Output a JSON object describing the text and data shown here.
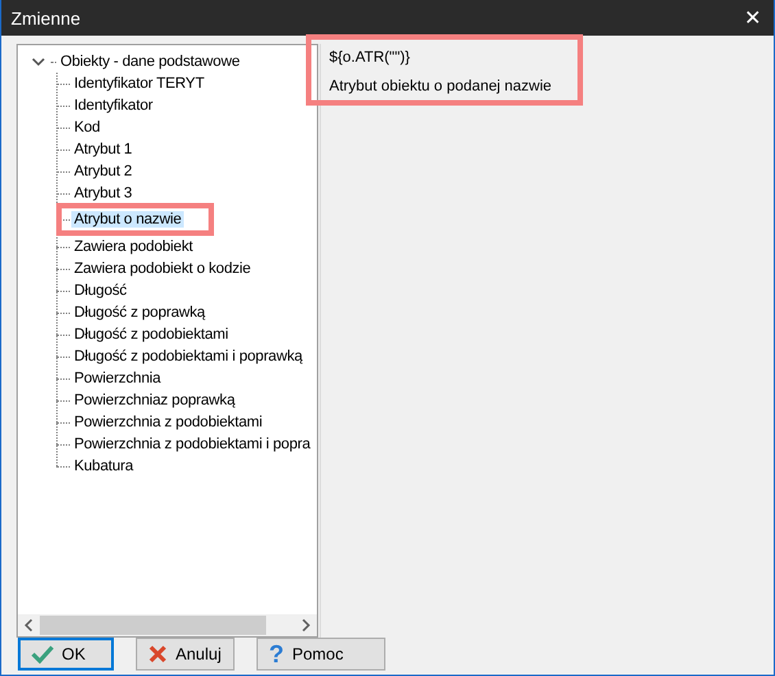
{
  "window": {
    "title": "Zmienne",
    "close": "✕"
  },
  "tree": {
    "label": "Obiekty - dane podstawowe",
    "expanded": true,
    "children": [
      {
        "label": "Identyfikator TERYT",
        "selected": false
      },
      {
        "label": "Identyfikator",
        "selected": false
      },
      {
        "label": "Kod",
        "selected": false
      },
      {
        "label": "Atrybut 1",
        "selected": false
      },
      {
        "label": "Atrybut 2",
        "selected": false
      },
      {
        "label": "Atrybut 3",
        "selected": false
      },
      {
        "label": "Atrybut o nazwie",
        "selected": true
      },
      {
        "label": "Zawiera podobiekt",
        "selected": false
      },
      {
        "label": "Zawiera podobiekt o kodzie",
        "selected": false
      },
      {
        "label": "Długość",
        "selected": false
      },
      {
        "label": "Długość z poprawką",
        "selected": false
      },
      {
        "label": "Długość z podobiektami",
        "selected": false
      },
      {
        "label": "Długość z podobiektami i poprawką",
        "selected": false
      },
      {
        "label": "Powierzchnia",
        "selected": false
      },
      {
        "label": "Powierzchniaz poprawką",
        "selected": false
      },
      {
        "label": "Powierzchnia z podobiektami",
        "selected": false
      },
      {
        "label": "Powierzchnia z podobiektami i popra",
        "selected": false
      },
      {
        "label": "Kubatura",
        "selected": false
      }
    ]
  },
  "detail": {
    "expression": "${o.ATR(\"\")}",
    "description": "Atrybut obiektu o podanej nazwie"
  },
  "buttons": [
    {
      "kind": "ok",
      "label": "OK",
      "default": true
    },
    {
      "kind": "cancel",
      "label": "Anuluj",
      "default": false
    },
    {
      "kind": "help",
      "label": "Pomoc",
      "default": false,
      "icon": "?"
    }
  ]
}
